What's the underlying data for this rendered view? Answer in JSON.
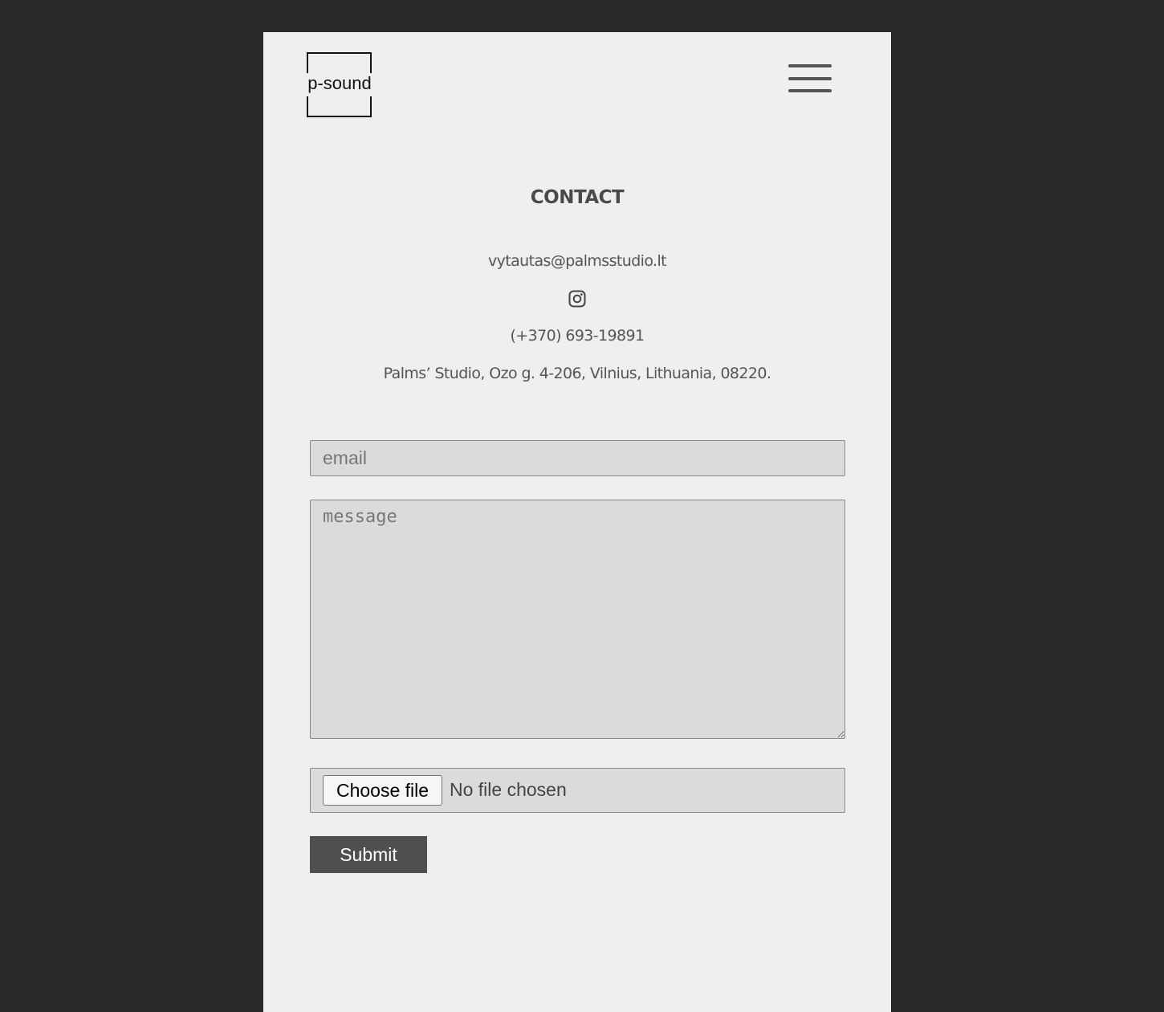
{
  "header": {
    "logo_text": "p-sound",
    "menu_icon": "hamburger-menu-icon"
  },
  "contact": {
    "title": "CONTACT",
    "email": "vytautas@palmsstudio.lt",
    "social_icon": "instagram-icon",
    "phone": "(+370) 693-19891",
    "address": "Palms’ Studio, Ozo g. 4-206, Vilnius, Lithuania, 08220."
  },
  "form": {
    "email_placeholder": "email",
    "message_placeholder": "message",
    "file_button_label": "Choose file",
    "file_status": "No file chosen",
    "submit_label": "Submit"
  },
  "colors": {
    "background": "#282828",
    "page": "#efefef",
    "field": "#dcdadb",
    "submit": "#4f4f4f"
  }
}
